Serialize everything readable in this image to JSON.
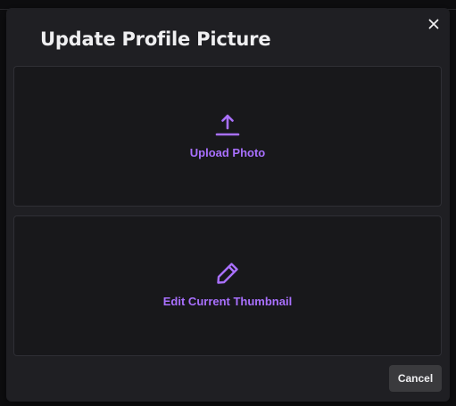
{
  "modal": {
    "title": "Update Profile Picture",
    "close_icon": "close-icon",
    "options": [
      {
        "label": "Upload Photo",
        "icon": "upload-icon"
      },
      {
        "label": "Edit Current Thumbnail",
        "icon": "pencil-icon"
      }
    ],
    "cancel_label": "Cancel"
  },
  "colors": {
    "accent": "#a970ff",
    "modal_background": "#1f1f23",
    "card_background": "#18181b",
    "title_text": "#efeff1",
    "cancel_background": "#3a3a3d"
  }
}
